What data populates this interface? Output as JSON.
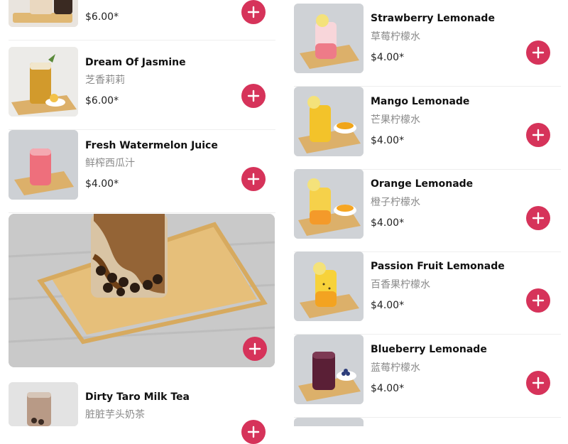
{
  "accent_color": "#d6335a",
  "left_column": [
    {
      "name": "",
      "price": "$6.00*",
      "image_icon": "drink-photo-icon"
    },
    {
      "name": "Dream Of Jasmine",
      "chinese": "芝香莉莉",
      "price": "$6.00*",
      "image_icon": "jasmine-tea-photo-icon"
    },
    {
      "name": "Fresh Watermelon Juice",
      "chinese": "鲜榨西瓜汁",
      "price": "$4.00*",
      "image_icon": "watermelon-juice-photo-icon"
    },
    {
      "name": "Dirty Taro Milk Tea",
      "chinese": "脏脏芋头奶茶",
      "image_icon": "taro-milk-tea-photo-icon"
    }
  ],
  "featured_image_icon": "brown-sugar-boba-photo-icon",
  "right_column": [
    {
      "name": "Strawberry Lemonade",
      "chinese": "草莓柠檬水",
      "price": "$4.00*",
      "image_icon": "strawberry-lemonade-photo-icon"
    },
    {
      "name": "Mango Lemonade",
      "chinese": "芒果柠檬水",
      "price": "$4.00*",
      "image_icon": "mango-lemonade-photo-icon"
    },
    {
      "name": "Orange Lemonade",
      "chinese": "橙子柠檬水",
      "price": "$4.00*",
      "image_icon": "orange-lemonade-photo-icon"
    },
    {
      "name": "Passion Fruit Lemonade",
      "chinese": "百香果柠檬水",
      "price": "$4.00*",
      "image_icon": "passion-fruit-lemonade-photo-icon"
    },
    {
      "name": "Blueberry Lemonade",
      "chinese": "蓝莓柠檬水",
      "price": "$4.00*",
      "image_icon": "blueberry-lemonade-photo-icon"
    }
  ],
  "add_button_icon": "plus-icon"
}
